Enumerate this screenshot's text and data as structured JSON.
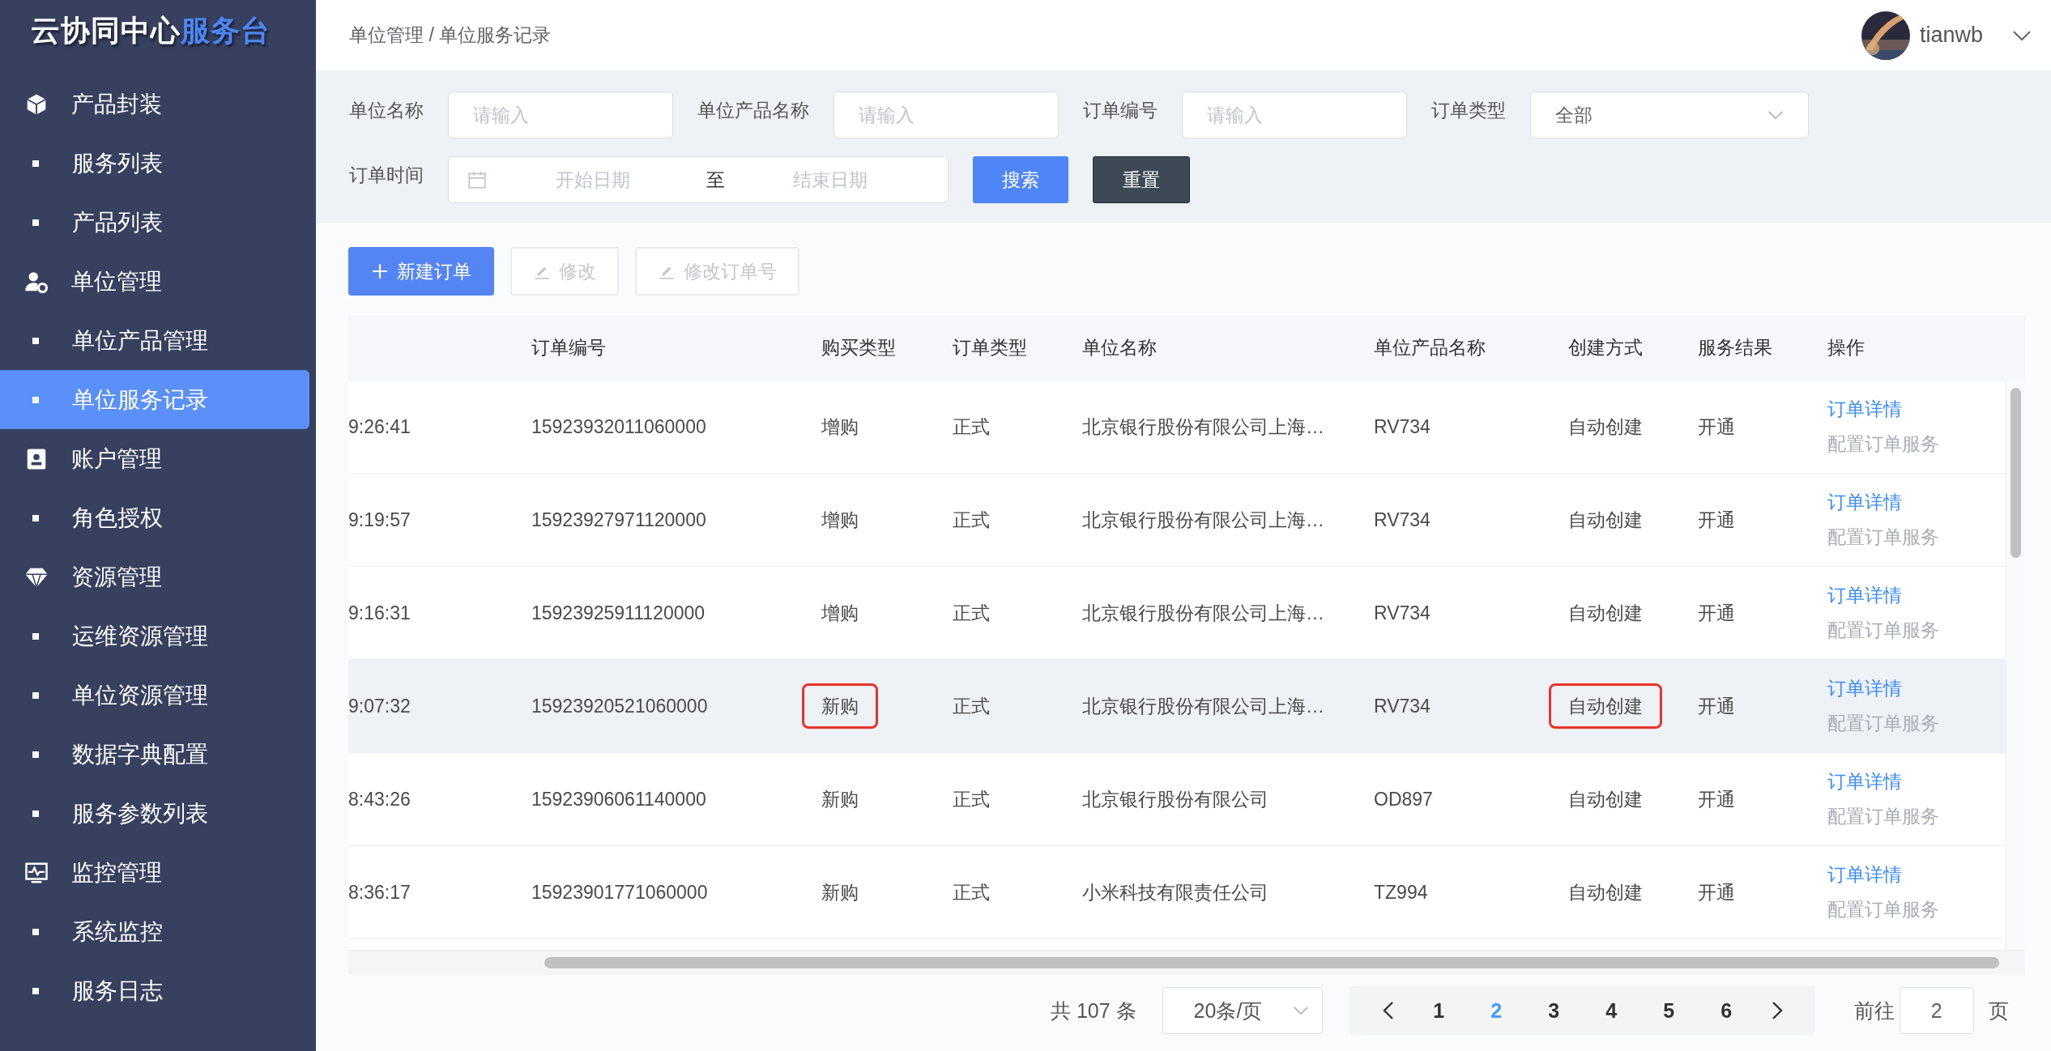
{
  "sidebar": {
    "logo": {
      "main": "云协同中心",
      "accent": "服务台"
    },
    "groups": [
      {
        "label": "产品封装",
        "kind": "cube",
        "children": [
          {
            "label": "服务列表",
            "selected": false
          },
          {
            "label": "产品列表",
            "selected": false
          }
        ]
      },
      {
        "label": "单位管理",
        "kind": "user-gear",
        "children": [
          {
            "label": "单位产品管理",
            "selected": false
          },
          {
            "label": "单位服务记录",
            "selected": true
          }
        ]
      },
      {
        "label": "账户管理",
        "kind": "badge",
        "children": [
          {
            "label": "角色授权",
            "selected": false
          }
        ]
      },
      {
        "label": "资源管理",
        "kind": "diamond",
        "children": [
          {
            "label": "运维资源管理",
            "selected": false
          },
          {
            "label": "单位资源管理",
            "selected": false
          },
          {
            "label": "数据字典配置",
            "selected": false
          },
          {
            "label": "服务参数列表",
            "selected": false
          }
        ]
      },
      {
        "label": "监控管理",
        "kind": "monitor",
        "children": [
          {
            "label": "系统监控",
            "selected": false
          },
          {
            "label": "服务日志",
            "selected": false
          }
        ]
      }
    ]
  },
  "header": {
    "breadcrumb": [
      "单位管理",
      "单位服务记录"
    ],
    "separator": "/",
    "user": "tianwb"
  },
  "filters": [
    {
      "label": "单位名称",
      "kind": "text",
      "placeholder": "请输入"
    },
    {
      "label": "单位产品名称",
      "kind": "text",
      "placeholder": "请输入"
    },
    {
      "label": "订单编号",
      "kind": "text",
      "placeholder": "请输入"
    },
    {
      "label": "订单类型",
      "kind": "select",
      "value": "全部"
    },
    {
      "label": "订单时间",
      "kind": "daterange",
      "start_placeholder": "开始日期",
      "separator": "至",
      "end_placeholder": "结束日期"
    }
  ],
  "filter_buttons": [
    {
      "label": "搜索",
      "kind": "primary"
    },
    {
      "label": "重置",
      "kind": "dark"
    }
  ],
  "toolbar": [
    {
      "label": "新建订单",
      "kind": "add",
      "disabled": false
    },
    {
      "label": "修改",
      "kind": "edit",
      "disabled": true
    },
    {
      "label": "修改订单号",
      "kind": "edit",
      "disabled": true
    }
  ],
  "table": {
    "columns": [
      "订单编号",
      "购买类型",
      "订单类型",
      "单位名称",
      "单位产品名称",
      "创建方式",
      "服务结果",
      "操作"
    ],
    "rows": [
      {
        "column_1": "9:26:41",
        "order_no": "15923932011060000",
        "purchase_type": "增购",
        "order_type": "正式",
        "unit_name": "北京银行股份有限公司上海…",
        "product": "RV734",
        "creation": "自动创建",
        "result": "开通",
        "hovered": false,
        "highlight_purchase": false,
        "highlight_creation": false,
        "actions": [
          {
            "label": "订单详情",
            "disabled": false
          },
          {
            "label": "配置订单服务",
            "disabled": true
          }
        ]
      },
      {
        "column_1": "9:19:57",
        "order_no": "15923927971120000",
        "purchase_type": "增购",
        "order_type": "正式",
        "unit_name": "北京银行股份有限公司上海…",
        "product": "RV734",
        "creation": "自动创建",
        "result": "开通",
        "hovered": false,
        "highlight_purchase": false,
        "highlight_creation": false,
        "actions": [
          {
            "label": "订单详情",
            "disabled": false
          },
          {
            "label": "配置订单服务",
            "disabled": true
          }
        ]
      },
      {
        "column_1": "9:16:31",
        "order_no": "15923925911120000",
        "purchase_type": "增购",
        "order_type": "正式",
        "unit_name": "北京银行股份有限公司上海…",
        "product": "RV734",
        "creation": "自动创建",
        "result": "开通",
        "hovered": false,
        "highlight_purchase": false,
        "highlight_creation": false,
        "actions": [
          {
            "label": "订单详情",
            "disabled": false
          },
          {
            "label": "配置订单服务",
            "disabled": true
          }
        ]
      },
      {
        "column_1": "9:07:32",
        "order_no": "15923920521060000",
        "purchase_type": "新购",
        "order_type": "正式",
        "unit_name": "北京银行股份有限公司上海…",
        "product": "RV734",
        "creation": "自动创建",
        "result": "开通",
        "hovered": true,
        "highlight_purchase": true,
        "highlight_creation": true,
        "actions": [
          {
            "label": "订单详情",
            "disabled": false
          },
          {
            "label": "配置订单服务",
            "disabled": true
          }
        ]
      },
      {
        "column_1": "8:43:26",
        "order_no": "15923906061140000",
        "purchase_type": "新购",
        "order_type": "正式",
        "unit_name": "北京银行股份有限公司",
        "product": "OD897",
        "creation": "自动创建",
        "result": "开通",
        "hovered": false,
        "highlight_purchase": false,
        "highlight_creation": false,
        "actions": [
          {
            "label": "订单详情",
            "disabled": false
          },
          {
            "label": "配置订单服务",
            "disabled": true
          }
        ]
      },
      {
        "column_1": "8:36:17",
        "order_no": "15923901771060000",
        "purchase_type": "新购",
        "order_type": "正式",
        "unit_name": "小米科技有限责任公司",
        "product": "TZ994",
        "creation": "自动创建",
        "result": "开通",
        "hovered": false,
        "highlight_purchase": false,
        "highlight_creation": false,
        "actions": [
          {
            "label": "订单详情",
            "disabled": false
          },
          {
            "label": "配置订单服务",
            "disabled": true
          }
        ]
      }
    ]
  },
  "pagination": {
    "total": "共 107 条",
    "page_size": "20条/页",
    "pages": [
      {
        "label": "1",
        "selected": false
      },
      {
        "label": "2",
        "selected": true
      },
      {
        "label": "3",
        "selected": false
      },
      {
        "label": "4",
        "selected": false
      },
      {
        "label": "5",
        "selected": false
      },
      {
        "label": "6",
        "selected": false
      }
    ],
    "jump_label": "前往",
    "jump_value": "2",
    "jump_suffix": "页"
  }
}
